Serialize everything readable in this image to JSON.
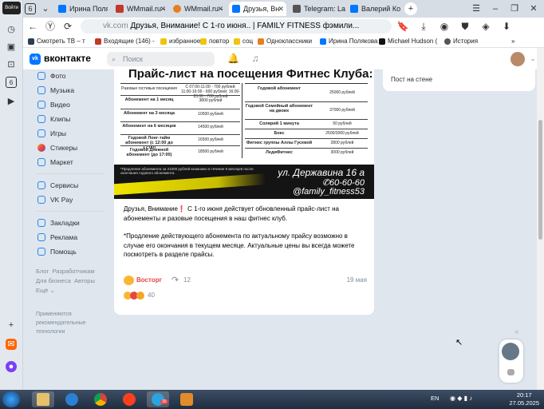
{
  "browser": {
    "side_badge": "Войти",
    "tabs": [
      {
        "label": "Ирина Поля",
        "color": "#0077ff"
      },
      {
        "label": "WMmail.ru -",
        "color": "#c0392b"
      },
      {
        "label": "WMmail.ru -",
        "color": "#e67e22"
      },
      {
        "label": "Друзья, Вн",
        "color": "#0077ff",
        "active": true
      },
      {
        "label": "Telegram: La",
        "color": "#555555"
      },
      {
        "label": "Валерий Ко",
        "color": "#0077ff"
      }
    ],
    "tab_count": "6",
    "url_domain": "vk.com",
    "url_title": "Друзья, Внимание! С 1-го июня.. | FAMILY FITNESS фэмили...",
    "bookmarks": [
      {
        "label": "Смотреть ТВ – т",
        "color": "#2c3e50"
      },
      {
        "label": "Входящие (146) -",
        "color": "#c0392b"
      },
      {
        "label": "избранное",
        "color": "#f1c40f"
      },
      {
        "label": "повтор",
        "color": "#f1c40f"
      },
      {
        "label": "соц",
        "color": "#f1c40f"
      },
      {
        "label": "Одноклассники",
        "color": "#e67e22"
      },
      {
        "label": "Ирина Полякова",
        "color": "#0077ff"
      },
      {
        "label": "Michael Hudson (",
        "color": "#111111"
      },
      {
        "label": "История",
        "color": "#555555"
      }
    ]
  },
  "vk": {
    "logo_text": "vk",
    "brand": "вконтакте",
    "search_placeholder": "Поиск",
    "menu": [
      "Фото",
      "Музыка",
      "Видео",
      "Клипы",
      "Игры",
      "Стикеры",
      "Маркет"
    ],
    "menu2": [
      "Сервисы",
      "VK Pay"
    ],
    "menu3": [
      "Закладки",
      "Реклама",
      "Помощь"
    ],
    "footer": {
      "blog": "Блог",
      "developers": "Разработчикам",
      "business": "Для бизнеса",
      "authors": "Авторы",
      "more": "Ещё"
    },
    "recommend_text": "Применяются рекомендательные технологии",
    "right_panel": "Пост на стене"
  },
  "post": {
    "image_title": "Прайс-лист на посещения Фитнес Клуба:",
    "price_left": [
      {
        "name": "Разовые гостевые посещения",
        "price": "С 07:00-11:00 - 700 рублей; 11:00-16:00 - 600 рублей; 16:00-23:00 - 700 рублей"
      },
      {
        "name": "Абонемент на 1 месяц",
        "price": "3800 рублей"
      },
      {
        "name": "Абонемент на 3 месяца",
        "price": "10500 рублей"
      },
      {
        "name": "Абонемент на 6 месяцев",
        "price": "14500 рублей"
      },
      {
        "name": "Годовой Лонг-тайм абонемент (с 12:00 до 17:00)",
        "price": "16500 рублей"
      },
      {
        "name": "Годовой Дневной абонемент (до 17:00)",
        "price": "18500 рублей"
      }
    ],
    "price_right": [
      {
        "name": "Годовой абонемент",
        "price": "25000 рублей"
      },
      {
        "name": "Годовой Семейный абонемент на двоих",
        "price": "37000 рублей"
      },
      {
        "name": "Солярий 1 минута",
        "price": "50 рублей"
      },
      {
        "name": "Бокс",
        "price": "2500/3000 рублей"
      },
      {
        "name": "Фитнес группы Аллы Гусевой",
        "price": "2800 рублей"
      },
      {
        "name": "ЛедиФитнес",
        "price": "3000 рублей"
      }
    ],
    "banner_fine": "*Продление абонемента за 21000 рублей возможно в течение 6 месяцев после окончания годового абонемента.",
    "banner_address": "ул. Державина 16 а",
    "banner_phone": "60-60-60",
    "banner_insta": "@family_fitness53",
    "text1": "Друзья, Внимание❗ С 1-го июня действует обновленный прайс-лист на абонементы и разовые посещения в наш фитнес клуб.",
    "text2": "*Продление действующего абонемента по актуальному прайсу возможно в случае его окончания в текущем месяце. Актуальные цены вы всегда можете посмотреть в разделе прайсы.",
    "reaction_label": "Восторг",
    "shares": "12",
    "date": "19 мая",
    "reactions_count": "40"
  },
  "taskbar": {
    "lang": "EN",
    "time": "20:17",
    "date": "27.05.2025",
    "telegram_badge": "30"
  }
}
